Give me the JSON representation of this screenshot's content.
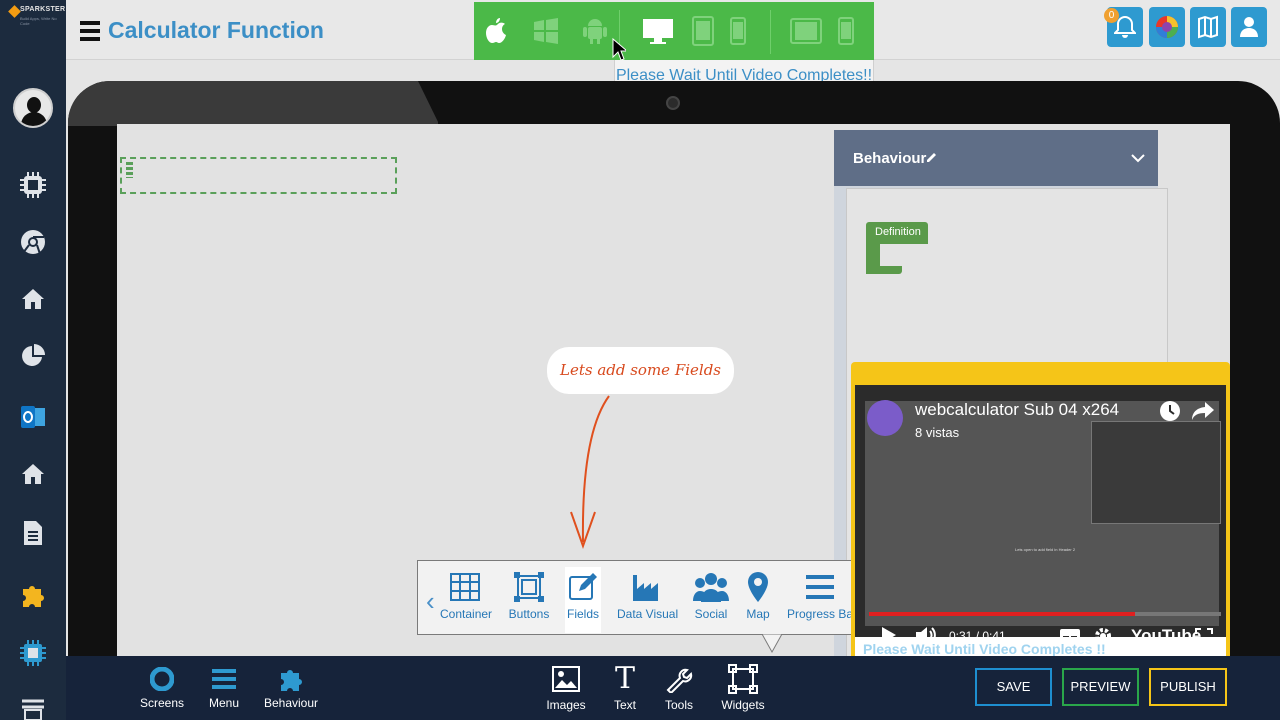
{
  "brand": {
    "name": "SPARKSTER",
    "tagline": "Build Apps, Write No Code"
  },
  "header": {
    "title": "Calculator Function",
    "notification_count": "0",
    "wait_message": "Please Wait Until Video Completes!!"
  },
  "device_bar": {
    "platforms": [
      "apple-icon",
      "windows-icon",
      "android-icon"
    ],
    "portrait_devices": [
      "desktop-icon",
      "tablet-icon",
      "phone-icon"
    ],
    "landscape_devices": [
      "tablet-landscape-icon",
      "phone-landscape-icon"
    ]
  },
  "sidebar": {
    "items": [
      "profile-avatar",
      "chip-icon",
      "chrome-icon",
      "home-icon",
      "pie-chart-icon",
      "outlook-icon",
      "home-icon",
      "document-icon",
      "puzzle-icon",
      "chip-icon",
      "stack-icon"
    ]
  },
  "behaviour_panel": {
    "title": "Behaviour",
    "block_label": "Definition"
  },
  "callout": "Lets add some Fields",
  "field_toolbar": {
    "items": [
      {
        "label": "Container",
        "icon": "grid-icon"
      },
      {
        "label": "Buttons",
        "icon": "frame-icon"
      },
      {
        "label": "Fields",
        "icon": "edit-icon"
      },
      {
        "label": "Data Visual",
        "icon": "chart-icon"
      },
      {
        "label": "Social",
        "icon": "people-icon"
      },
      {
        "label": "Map",
        "icon": "map-pin-icon"
      },
      {
        "label": "Progress Bar",
        "icon": "bars-icon"
      }
    ],
    "active": "Fields"
  },
  "video": {
    "title": "webcalculator Sub 04 x264",
    "views": "8 vistas",
    "time": "0:31 / 0:41",
    "progress": 0.756,
    "brand": "YouTube",
    "caption": "Please Wait Until Video Completes !!",
    "inner_text": "Lets open to add field in Header 2"
  },
  "bottom_bar": {
    "left_items": [
      "Screens",
      "Menu",
      "Behaviour"
    ],
    "center_items": [
      "Images",
      "Text",
      "Tools",
      "Widgets"
    ],
    "actions": {
      "save": "SAVE",
      "preview": "PREVIEW",
      "publish": "PUBLISH"
    }
  },
  "colors": {
    "sidebar_bg": "#1c2b3e",
    "accent_blue": "#3c8fc6",
    "device_bar_green": "#4bb948",
    "video_border": "#f5c518",
    "save_border": "#1e8fd0",
    "preview_border": "#2aa64a",
    "publish_border": "#f5c518"
  }
}
